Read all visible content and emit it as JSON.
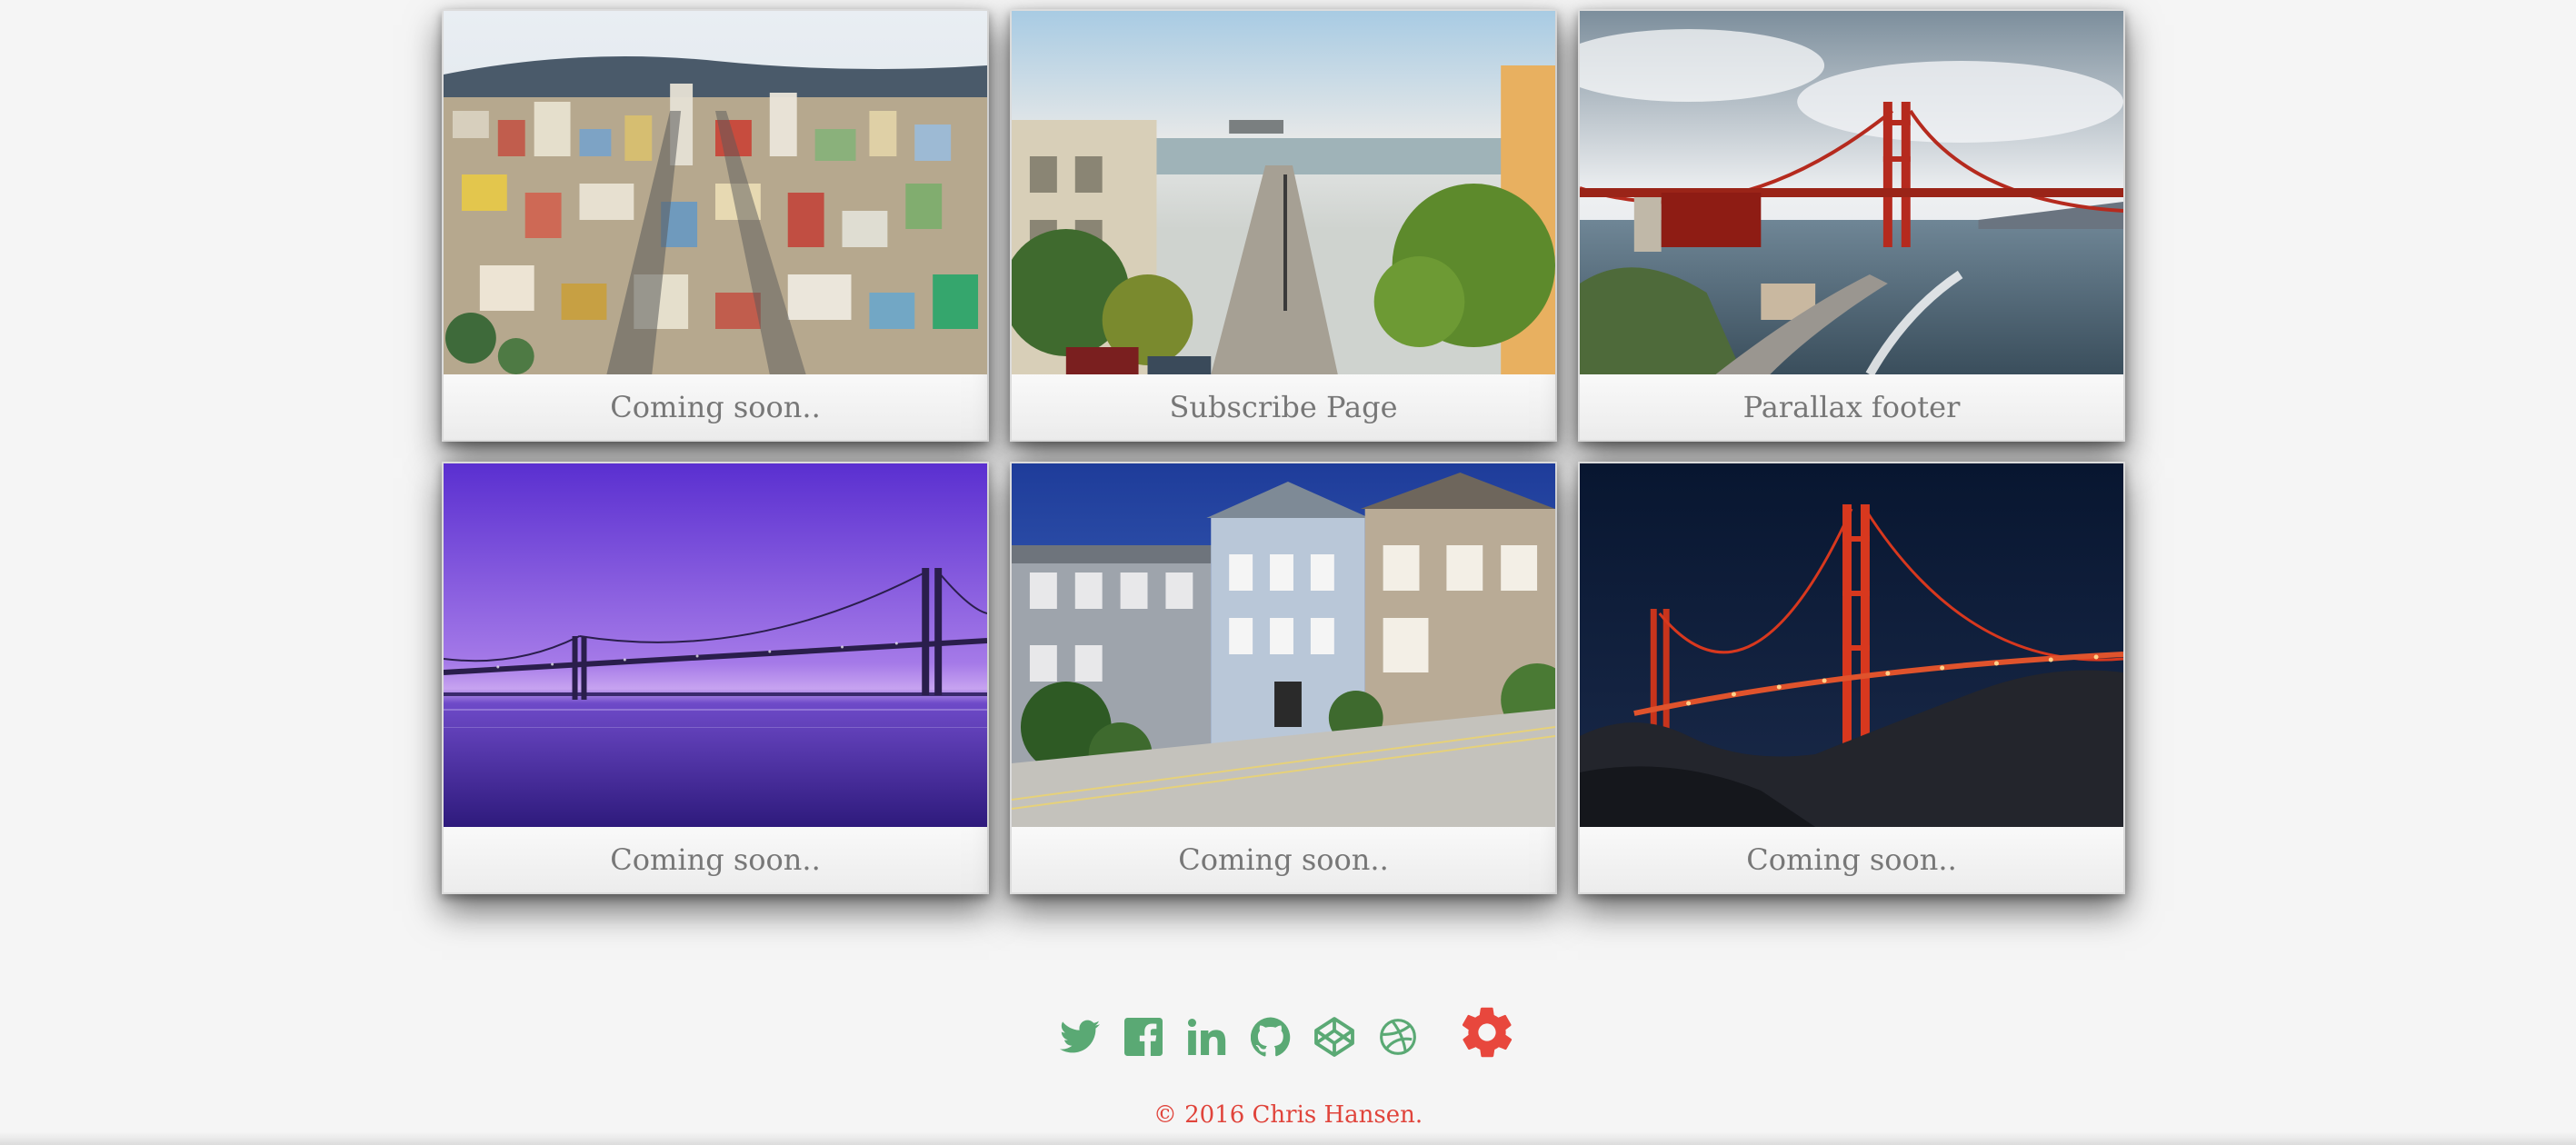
{
  "cards": [
    {
      "caption": "Coming soon..",
      "image": "san-francisco-cityscape"
    },
    {
      "caption": "Subscribe Page",
      "image": "street-view-alcatraz"
    },
    {
      "caption": "Parallax footer",
      "image": "golden-gate-day"
    },
    {
      "caption": "Coming soon..",
      "image": "bay-bridge-purple-dusk"
    },
    {
      "caption": "Coming soon..",
      "image": "victorian-houses"
    },
    {
      "caption": "Coming soon..",
      "image": "golden-gate-night"
    }
  ],
  "social": [
    {
      "name": "twitter-icon"
    },
    {
      "name": "facebook-icon"
    },
    {
      "name": "linkedin-icon"
    },
    {
      "name": "github-icon"
    },
    {
      "name": "codepen-icon"
    },
    {
      "name": "dribbble-icon"
    },
    {
      "name": "gear-icon"
    }
  ],
  "colors": {
    "icon_green": "#5aa974",
    "accent_red": "#e8473d",
    "caption_text": "#777777",
    "background": "#f5f5f5"
  },
  "footer": {
    "copyright": "© 2016 Chris Hansen."
  }
}
